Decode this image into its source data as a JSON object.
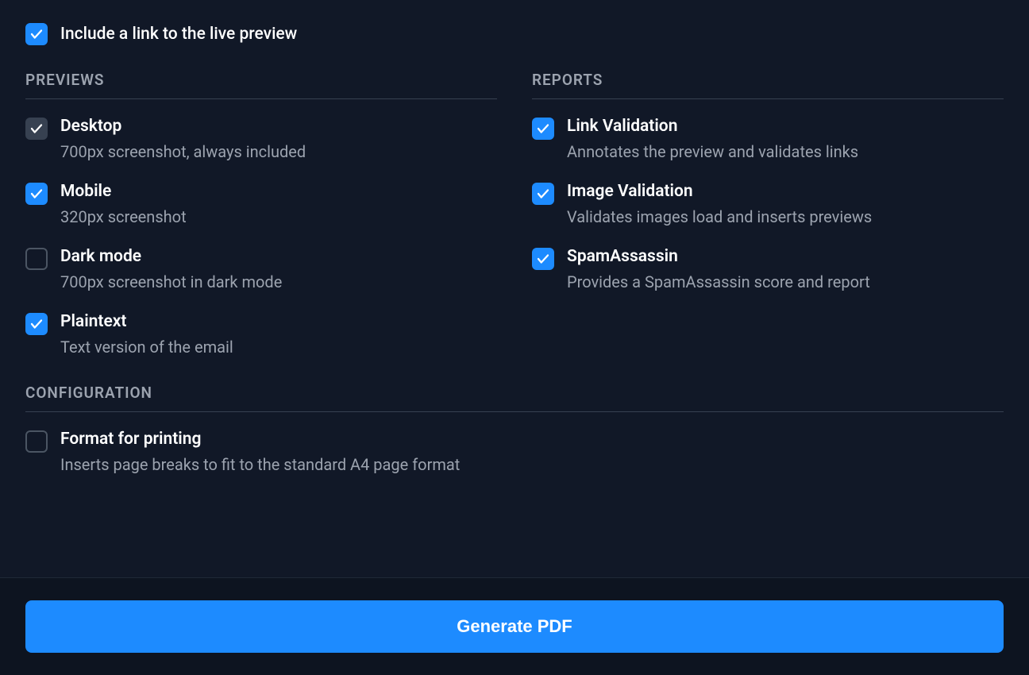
{
  "top_option": {
    "label": "Include a link to the live preview",
    "checked": true
  },
  "previews": {
    "header": "PREVIEWS",
    "items": [
      {
        "title": "Desktop",
        "description": "700px screenshot, always included",
        "state": "checked-disabled"
      },
      {
        "title": "Mobile",
        "description": "320px screenshot",
        "state": "checked"
      },
      {
        "title": "Dark mode",
        "description": "700px screenshot in dark mode",
        "state": "unchecked"
      },
      {
        "title": "Plaintext",
        "description": "Text version of the email",
        "state": "checked"
      }
    ]
  },
  "reports": {
    "header": "REPORTS",
    "items": [
      {
        "title": "Link Validation",
        "description": "Annotates the preview and validates links",
        "state": "checked"
      },
      {
        "title": "Image Validation",
        "description": "Validates images load and inserts previews",
        "state": "checked"
      },
      {
        "title": "SpamAssassin",
        "description": "Provides a SpamAssassin score and report",
        "state": "checked"
      }
    ]
  },
  "configuration": {
    "header": "CONFIGURATION",
    "items": [
      {
        "title": "Format for printing",
        "description": "Inserts page breaks to fit to the standard A4 page format",
        "state": "unchecked"
      }
    ]
  },
  "generate_button": "Generate PDF"
}
